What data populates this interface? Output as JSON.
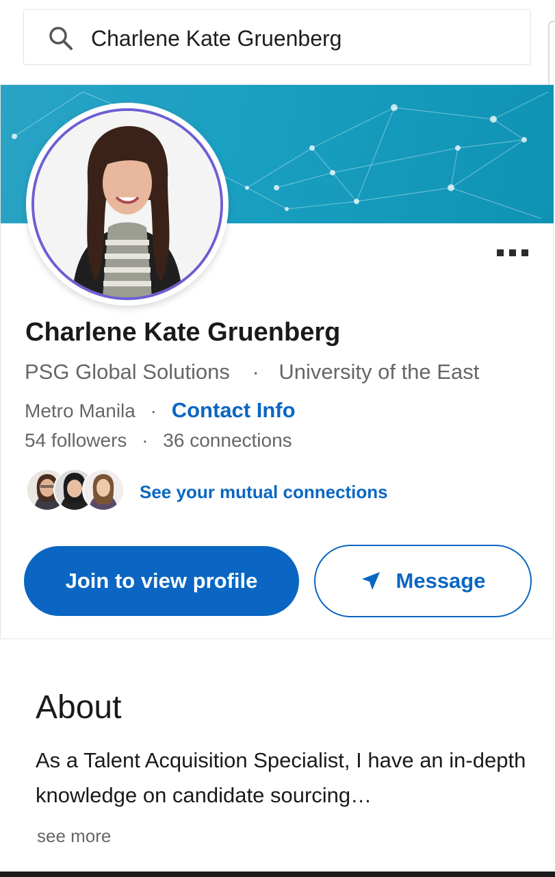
{
  "search": {
    "query": "Charlene Kate Gruenberg"
  },
  "profile": {
    "name": "Charlene Kate Gruenberg",
    "company": "PSG Global Solutions",
    "school": "University of the East",
    "location": "Metro Manila",
    "contact_info_label": "Contact Info",
    "followers": "54 followers",
    "connections": "36 connections",
    "separator": "·",
    "mutual_connections_label": "See your mutual connections"
  },
  "actions": {
    "join_label": "Join to view profile",
    "message_label": "Message"
  },
  "about": {
    "title": "About",
    "text": "As a Talent Acquisition Specialist, I have an in-depth knowledge on candidate sourcing…",
    "see_more_label": "see more"
  },
  "colors": {
    "accent": "#0a66c2",
    "banner": "#1aa0c2",
    "avatar_ring": "#6c5fd3",
    "text_secondary": "#666666"
  },
  "icons": {
    "search": "search-icon",
    "more": "more-options-icon",
    "message": "send-icon"
  }
}
